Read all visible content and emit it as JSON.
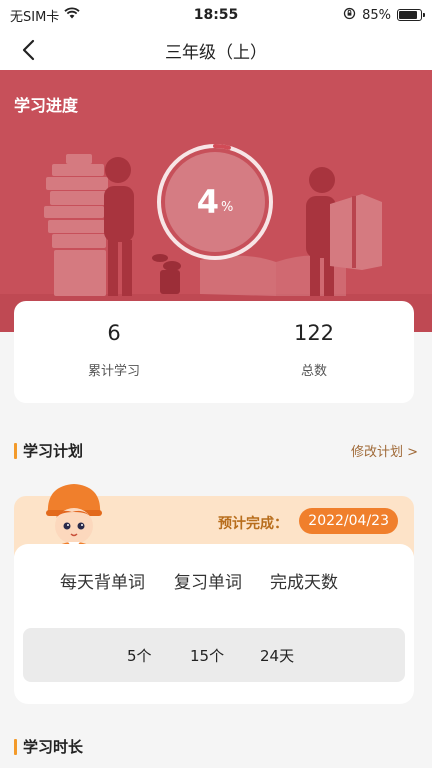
{
  "status_bar": {
    "carrier": "无SIM卡",
    "time": "18:55",
    "battery": "85%",
    "battery_level": 0.85
  },
  "nav": {
    "title": "三年级（上）"
  },
  "progress": {
    "section_title": "学习进度",
    "percent_value": "4",
    "percent_unit": "%",
    "fraction": 0.04
  },
  "stats": [
    {
      "value": "6",
      "label": "累计学习"
    },
    {
      "value": "122",
      "label": "总数"
    }
  ],
  "plan": {
    "section_title": "学习计划",
    "edit_link": "修改计划 >",
    "estimate_label": "预计完成：",
    "estimate_date": "2022/04/23",
    "headers": [
      "每天背单词",
      "复习单词",
      "完成天数"
    ],
    "values": [
      "5个",
      "15个",
      "24天"
    ]
  },
  "duration": {
    "section_title": "学习时长"
  },
  "colors": {
    "hero": "#c7505a",
    "accent": "#f39a2a",
    "date_badge": "#f07f2c"
  }
}
